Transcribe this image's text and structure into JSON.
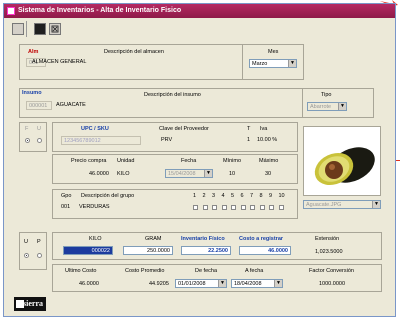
{
  "window": {
    "title": "Sistema de Inventarios - Alta de Inventario Fisico"
  },
  "almacen": {
    "label": "Alm",
    "desc_header": "Descripción del almacen",
    "code": "001",
    "name": "ALMACEN GENERAL"
  },
  "mes": {
    "label": "Mes",
    "value": "Marzo"
  },
  "insumo": {
    "label": "Insumo",
    "desc_header": "Descripción del insumo",
    "code": "000001",
    "name": "AGUACATE"
  },
  "tipo": {
    "label": "Tipo",
    "value": "Abarrote"
  },
  "fu": {
    "f_label": "F",
    "u_label": "U"
  },
  "upc": {
    "label": "UPC / SKU",
    "value": "123456789012",
    "prov_label": "Clave del Proveedor",
    "prov_value": "PRV",
    "t_label": "T",
    "t_value": "1",
    "iva_label": "Iva",
    "iva_value": "10.00 %"
  },
  "compra": {
    "precio_label": "Precio compra",
    "unidad_label": "Unidad",
    "precio_value": "46.0000",
    "unidad_value": "KILO",
    "fecha_label": "Fecha",
    "fecha_value": "15/04/2008",
    "minimo_label": "Mínimo",
    "minimo_value": "10",
    "maximo_label": "Máximo",
    "maximo_value": "30"
  },
  "grupo": {
    "gpo_label": "Gpo",
    "desc_label": "Descripción del grupo",
    "code": "001",
    "name": "VERDURAS",
    "numbers": [
      "1",
      "2",
      "3",
      "4",
      "5",
      "6",
      "7",
      "8",
      "9",
      "10"
    ]
  },
  "image": {
    "filename": "Aguacate.JPG"
  },
  "conteo": {
    "u_label": "U",
    "p_label": "P",
    "kilo_label": "KILO",
    "kilo_value": "000022",
    "gram_label": "GRAM",
    "gram_value": "250.0000",
    "inv_label": "Inventario Físico",
    "inv_value": "22.2500",
    "costo_label": "Costo a registrar",
    "costo_value": "46.0000",
    "ext_label": "Extensión",
    "ext_value": "1,023.5000"
  },
  "costos": {
    "ultimo_label": "Ultimo Costo",
    "ultimo_value": "46.0000",
    "promedio_label": "Costo Promedio",
    "promedio_value": "44.9205",
    "de_label": "De fecha",
    "de_value": "01/01/2008",
    "a_label": "A fecha",
    "a_value": "18/04/2008",
    "factor_label": "Factor Conversión",
    "factor_value": "1000.0000"
  },
  "brand": {
    "logo": "sierra"
  }
}
